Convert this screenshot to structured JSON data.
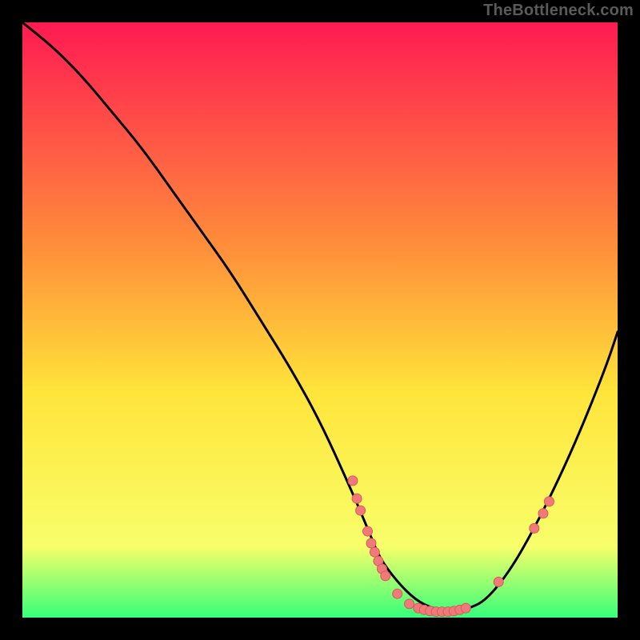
{
  "watermark": "TheBottleneck.com",
  "colors": {
    "bg": "#000000",
    "grad_top": "#ff1a52",
    "grad_mid1": "#ff8f3a",
    "grad_mid2": "#ffe43a",
    "grad_mid3": "#f8ff6a",
    "grad_bottom": "#36ff7a",
    "curve": "#000000",
    "dot_fill": "#f07a7a",
    "dot_stroke": "#d85a5a"
  },
  "chart_data": {
    "type": "line",
    "title": "",
    "xlabel": "",
    "ylabel": "",
    "xlim": [
      0,
      100
    ],
    "ylim": [
      0,
      100
    ],
    "curve": {
      "x": [
        0,
        5,
        10,
        15,
        20,
        25,
        30,
        35,
        40,
        45,
        50,
        55,
        58,
        60,
        63,
        66,
        69,
        72,
        75,
        78,
        82,
        86,
        90,
        94,
        98,
        100
      ],
      "y": [
        100,
        96,
        91,
        85,
        79,
        72,
        65,
        58,
        50,
        42,
        33,
        22,
        15,
        10,
        6,
        3,
        1.5,
        1,
        1.5,
        3,
        8,
        15,
        23,
        32,
        42,
        48
      ]
    },
    "dots": [
      {
        "x": 55.5,
        "y": 23
      },
      {
        "x": 56.2,
        "y": 20
      },
      {
        "x": 56.8,
        "y": 18
      },
      {
        "x": 58.0,
        "y": 14.5
      },
      {
        "x": 58.6,
        "y": 12.5
      },
      {
        "x": 59.2,
        "y": 11
      },
      {
        "x": 59.8,
        "y": 9.5
      },
      {
        "x": 60.4,
        "y": 8.2
      },
      {
        "x": 61.0,
        "y": 7
      },
      {
        "x": 63.0,
        "y": 4
      },
      {
        "x": 65.0,
        "y": 2.3
      },
      {
        "x": 66.5,
        "y": 1.6
      },
      {
        "x": 67.5,
        "y": 1.3
      },
      {
        "x": 68.5,
        "y": 1.1
      },
      {
        "x": 69.5,
        "y": 1.0
      },
      {
        "x": 70.5,
        "y": 1.0
      },
      {
        "x": 71.5,
        "y": 1.0
      },
      {
        "x": 72.5,
        "y": 1.1
      },
      {
        "x": 73.5,
        "y": 1.3
      },
      {
        "x": 74.5,
        "y": 1.6
      },
      {
        "x": 80.0,
        "y": 6
      },
      {
        "x": 86.0,
        "y": 15
      },
      {
        "x": 87.5,
        "y": 17.5
      },
      {
        "x": 88.5,
        "y": 19.5
      }
    ]
  }
}
